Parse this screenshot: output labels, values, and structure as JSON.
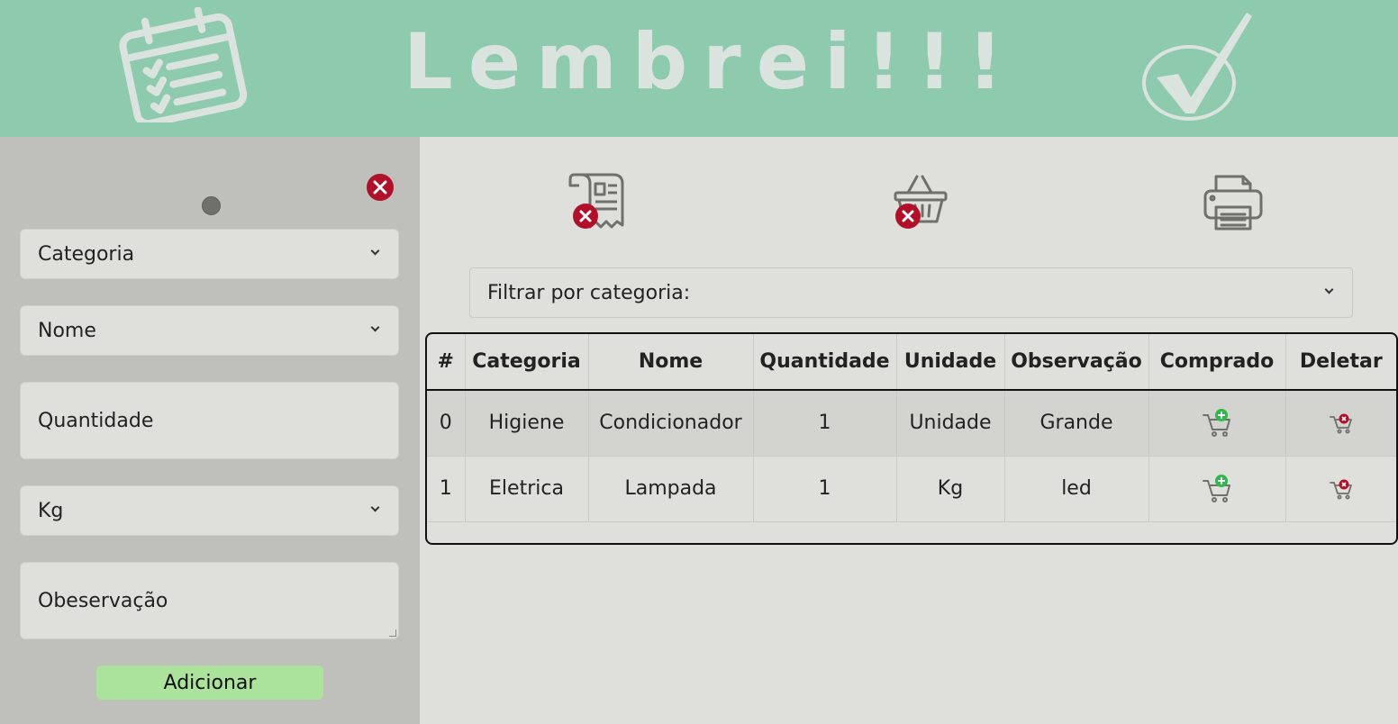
{
  "header": {
    "title": "Lembrei!!!",
    "left_icon": "calendar-checklist-icon",
    "right_icon": "checkmark-circle-icon",
    "background_color": "#8ecaae"
  },
  "form": {
    "close_icon": "close-circle-icon",
    "category_select": "Categoria",
    "name_select": "Nome",
    "quantity_placeholder": "Quantidade",
    "unit_select": "Kg",
    "observation_placeholder": "Obeservação",
    "add_button": "Adicionar",
    "add_button_color": "#abe29c"
  },
  "toolbar": {
    "icons": [
      "clear-list-icon",
      "clear-basket-icon",
      "printer-icon"
    ]
  },
  "filter": {
    "label": "Filtrar por categoria:"
  },
  "table": {
    "headers": [
      "#",
      "Categoria",
      "Nome",
      "Quantidade",
      "Unidade",
      "Observação",
      "Comprado",
      "Deletar"
    ],
    "rows": [
      {
        "index": "0",
        "categoria": "Higiene",
        "nome": "Condicionador",
        "quantidade": "1",
        "unidade": "Unidade",
        "observacao": "Grande"
      },
      {
        "index": "1",
        "categoria": "Eletrica",
        "nome": "Lampada",
        "quantidade": "1",
        "unidade": "Kg",
        "observacao": "led"
      }
    ],
    "bought_icon": "cart-add-icon",
    "delete_icon": "cart-remove-icon",
    "accent_green": "#2eb84a",
    "accent_red": "#b0102a"
  }
}
